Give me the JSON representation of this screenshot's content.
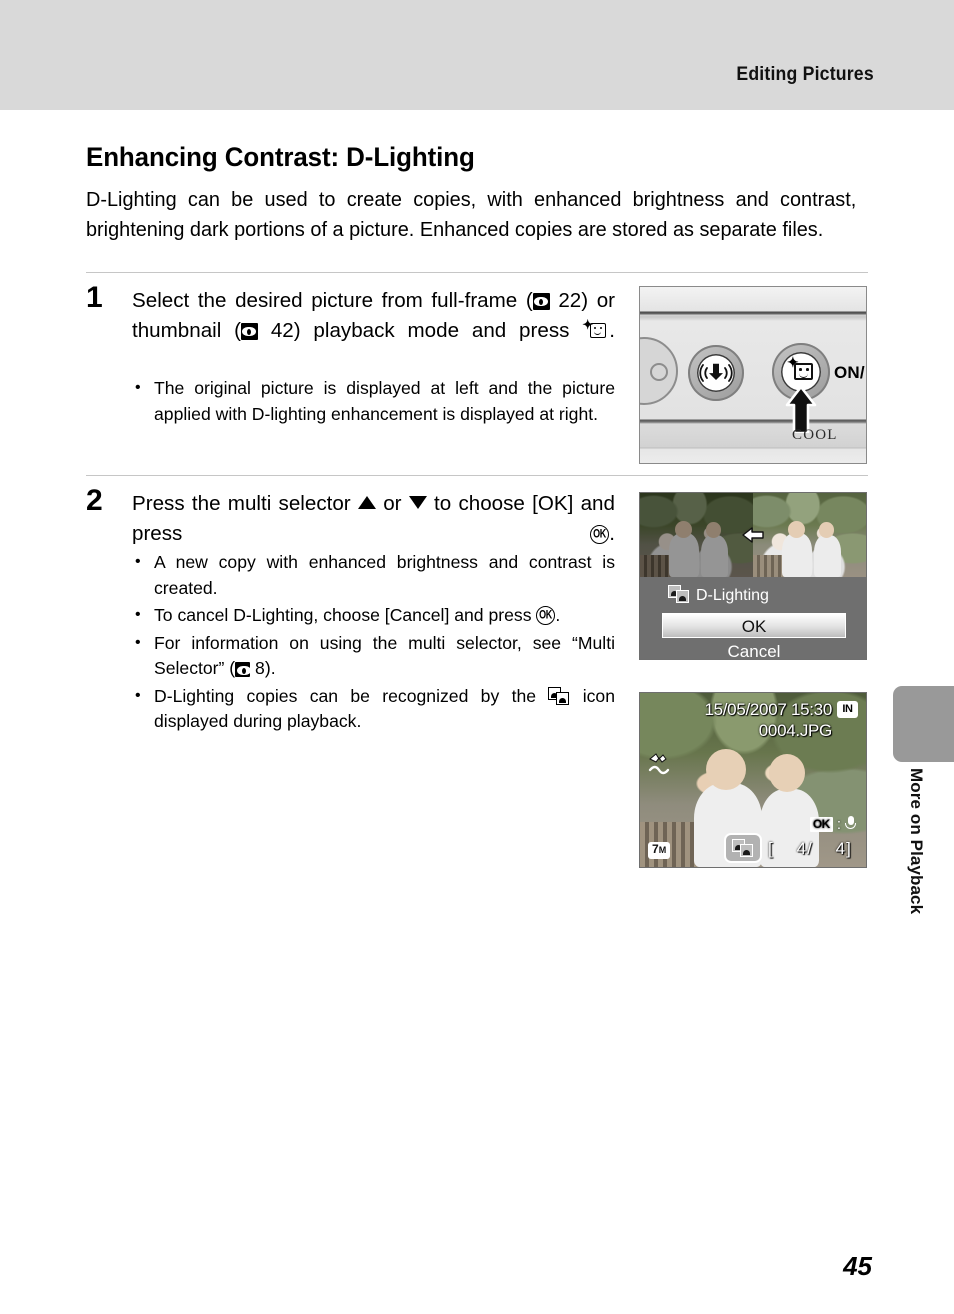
{
  "header": {
    "section_title": "Editing Pictures"
  },
  "page_title": "Enhancing Contrast: D-Lighting",
  "intro": "D-Lighting can be used to create copies, with enhanced brightness and contrast, brightening dark portions of a picture. Enhanced copies are stored as separate files.",
  "steps": [
    {
      "number": "1",
      "head_part1": "Select the desired picture from full-frame (",
      "ref1": "22",
      "head_part2": ") or thumbnail (",
      "ref2": "42",
      "head_part3": ") playback mode and press",
      "head_end": ".",
      "bullets": [
        "The original picture is displayed at left and the picture applied with D-lighting enhancement is displayed at right."
      ]
    },
    {
      "number": "2",
      "head_part1": "Press the multi selector",
      "head_part2": "or",
      "head_part3": "to choose [OK] and press",
      "head_end": ".",
      "bullets": [
        {
          "text_before": "A new copy with enhanced brightness and contrast is created.",
          "text_after": ""
        },
        {
          "text_before": "To cancel D-Lighting, choose [Cancel] and press",
          "text_after": "."
        },
        {
          "text_before": "For information on using the multi selector, see “Multi Selector” (",
          "ref": "8",
          "text_after": ")."
        },
        {
          "text_before": "D-Lighting copies can be recognized by the",
          "text_after": "icon displayed during playback."
        }
      ]
    }
  ],
  "camera_figure": {
    "power_label": "ON/",
    "brand_label": "COOL",
    "vr_button_name": "vibration-reduction-button",
    "dlighting_button_name": "d-lighting-button"
  },
  "menu_screen": {
    "title": "D-Lighting",
    "options": [
      {
        "label": "OK",
        "selected": true
      },
      {
        "label": "Cancel",
        "selected": false
      }
    ]
  },
  "playback_screen": {
    "datetime": "15/05/2007 15:30",
    "memory_badge": "IN",
    "filename": "0004.JPG",
    "resolution_badge": "7",
    "resolution_unit": "M",
    "counter": "[    4/    4]",
    "ok_badge": "OK",
    "ok_separator": ":"
  },
  "side_tab": {
    "label": "More on Playback"
  },
  "page_number": "45",
  "colors": {
    "header_bg": "#d9d9d9",
    "side_tab_bg": "#999999",
    "rule": "#c6c6c6",
    "text": "#000000"
  }
}
